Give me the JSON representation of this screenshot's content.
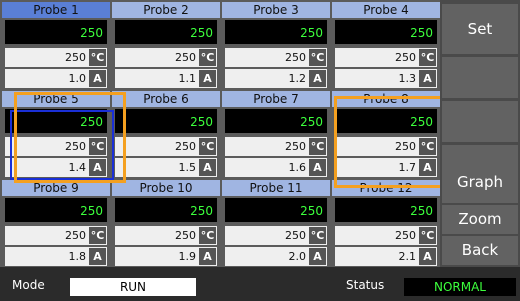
{
  "probes": [
    {
      "name": "Probe 1",
      "value": "250",
      "temp": "250",
      "temp_unit": "°C",
      "current": "1.0",
      "current_unit": "A"
    },
    {
      "name": "Probe 2",
      "value": "250",
      "temp": "250",
      "temp_unit": "°C",
      "current": "1.1",
      "current_unit": "A"
    },
    {
      "name": "Probe 3",
      "value": "250",
      "temp": "250",
      "temp_unit": "°C",
      "current": "1.2",
      "current_unit": "A"
    },
    {
      "name": "Probe 4",
      "value": "250",
      "temp": "250",
      "temp_unit": "°C",
      "current": "1.3",
      "current_unit": "A"
    },
    {
      "name": "Probe 5",
      "value": "250",
      "temp": "250",
      "temp_unit": "°C",
      "current": "1.4",
      "current_unit": "A"
    },
    {
      "name": "Probe 6",
      "value": "250",
      "temp": "250",
      "temp_unit": "°C",
      "current": "1.5",
      "current_unit": "A"
    },
    {
      "name": "Probe 7",
      "value": "250",
      "temp": "250",
      "temp_unit": "°C",
      "current": "1.6",
      "current_unit": "A"
    },
    {
      "name": "Probe 8",
      "value": "250",
      "temp": "250",
      "temp_unit": "°C",
      "current": "1.7",
      "current_unit": "A"
    },
    {
      "name": "Probe 9",
      "value": "250",
      "temp": "250",
      "temp_unit": "°C",
      "current": "1.8",
      "current_unit": "A"
    },
    {
      "name": "Probe 10",
      "value": "250",
      "temp": "250",
      "temp_unit": "°C",
      "current": "1.9",
      "current_unit": "A"
    },
    {
      "name": "Probe 11",
      "value": "250",
      "temp": "250",
      "temp_unit": "°C",
      "current": "2.0",
      "current_unit": "A"
    },
    {
      "name": "Probe 12",
      "value": "250",
      "temp": "250",
      "temp_unit": "°C",
      "current": "2.1",
      "current_unit": "A"
    }
  ],
  "sidebar": {
    "set_label": "Set",
    "graph_label": "Graph",
    "zoom_label": "Zoom",
    "back_label": "Back"
  },
  "status_bar": {
    "mode_label": "Mode",
    "mode_value": "RUN",
    "status_label": "Status",
    "status_value": "NORMAL"
  },
  "colors": {
    "title_bg": "#a0b5e2",
    "title_bg_selected": "#5a7fd6",
    "value_text": "#3cff3c",
    "highlight": "#f4a020",
    "selection": "#1a2fd6"
  }
}
